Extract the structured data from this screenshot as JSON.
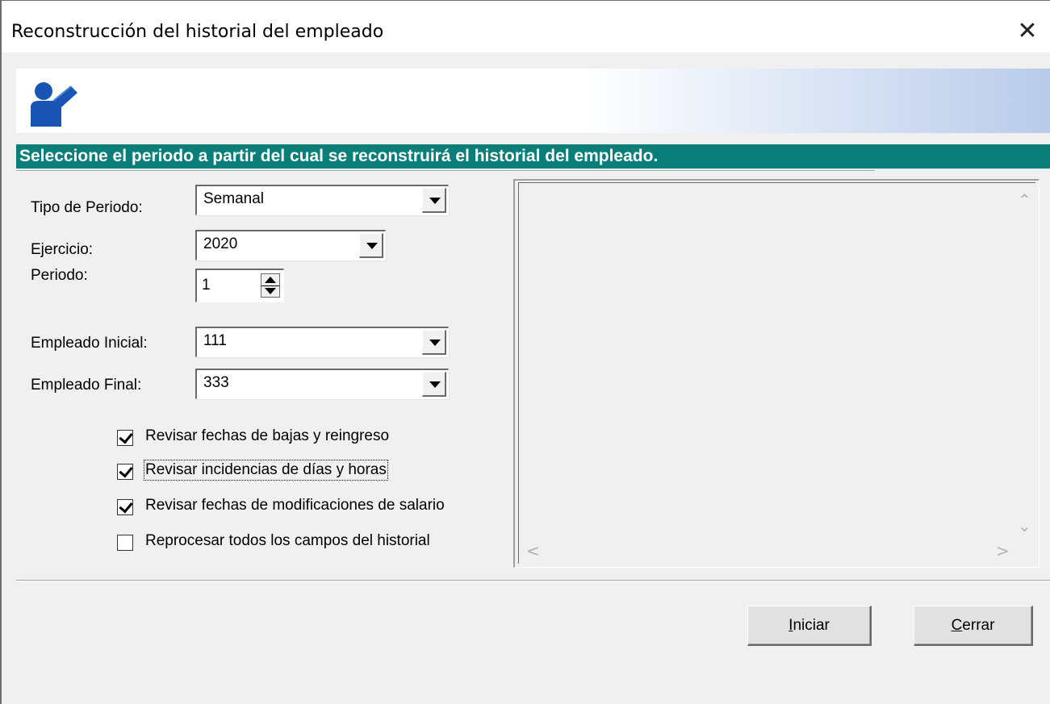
{
  "window": {
    "title": "Reconstrucción del historial del empleado",
    "close_glyph": "✕"
  },
  "banner": {
    "icon": "user-icon",
    "heading": "Seleccione el periodo a partir del cual se reconstruirá el historial del empleado.",
    "heading_color": "#0a7e78"
  },
  "form": {
    "tipo_periodo": {
      "label": "Tipo de Periodo:",
      "value": "Semanal"
    },
    "ejercicio": {
      "label": "Ejercicio:",
      "value": "2020"
    },
    "periodo": {
      "label": "Periodo:",
      "value": "1"
    },
    "empleado_inicial": {
      "label": "Empleado Inicial:",
      "value": "111"
    },
    "empleado_final": {
      "label": "Empleado Final:",
      "value": "333"
    }
  },
  "options": [
    {
      "label": "Revisar fechas de bajas y reingreso",
      "checked": true
    },
    {
      "label": "Revisar incidencias de días y horas",
      "checked": true
    },
    {
      "label": "Revisar fechas de modificaciones de salario",
      "checked": true
    },
    {
      "label": "Reprocesar todos los campos del historial",
      "checked": false
    }
  ],
  "log": {
    "up_glyph": "⌃",
    "down_glyph": "⌄",
    "left_glyph": "<",
    "right_glyph": ">"
  },
  "buttons": {
    "iniciar": {
      "accel": "I",
      "rest": "niciar"
    },
    "cerrar": {
      "accel": "C",
      "rest": "errar"
    }
  }
}
